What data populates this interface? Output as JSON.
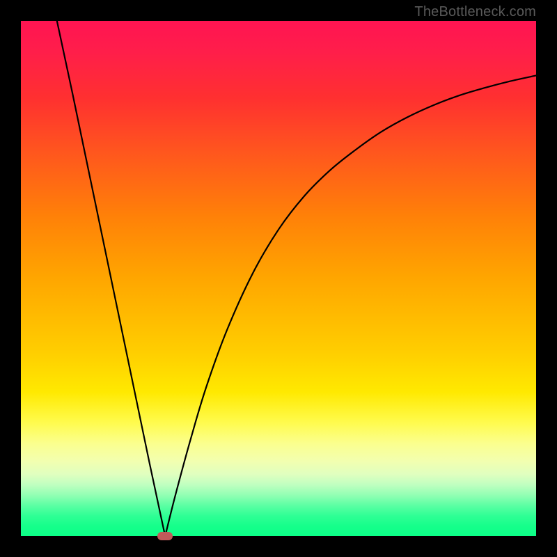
{
  "watermark": "TheBottleneck.com",
  "colors": {
    "frame": "#000000",
    "curve_stroke": "#000000",
    "marker_fill": "#c15a5a",
    "gradient_top": "#ff1452",
    "gradient_bottom": "#0cff87"
  },
  "chart_data": {
    "type": "line",
    "title": "",
    "xlabel": "",
    "ylabel": "",
    "xlim": [
      0,
      100
    ],
    "ylim": [
      0,
      100
    ],
    "grid": false,
    "legend": false,
    "series": [
      {
        "name": "left-branch",
        "x": [
          7,
          10,
          15,
          20,
          25,
          28
        ],
        "values": [
          100,
          86,
          62,
          38,
          14,
          0
        ]
      },
      {
        "name": "right-branch",
        "x": [
          28,
          30,
          33,
          36,
          40,
          45,
          50,
          55,
          60,
          65,
          70,
          75,
          80,
          85,
          90,
          95,
          100
        ],
        "values": [
          0,
          8,
          19,
          29,
          40,
          51,
          59.5,
          66,
          71,
          75,
          78.5,
          81.3,
          83.6,
          85.5,
          87,
          88.3,
          89.4
        ]
      }
    ],
    "annotations": [
      {
        "name": "min-marker",
        "x": 28,
        "y": 0
      }
    ]
  }
}
